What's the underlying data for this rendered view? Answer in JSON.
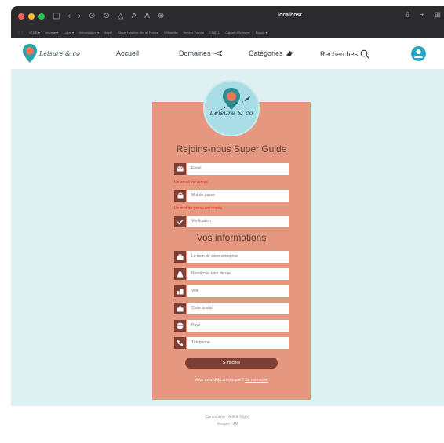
{
  "browser": {
    "url": "localhost",
    "nav_glyphs": [
      "◫",
      "‹",
      "›",
      "⊙",
      "⊙",
      "△",
      "A",
      "A",
      "⊕"
    ],
    "right_glyphs": [
      "⇧",
      "+",
      "⊞"
    ],
    "bookmarks": [
      "⋮⋮ ",
      "VTBR ▾",
      "Voyage ▾",
      "Local ▾",
      "Alimentation ▾",
      "Apple",
      "Stage Hygiène Jeu et France",
      "Wikipedia",
      "Heroes France",
      "CNRTL",
      "Caisse d'Epargne",
      "Essais ▾"
    ]
  },
  "nav": {
    "logo_text": "Leisure & co",
    "items": [
      {
        "label": "Accueil"
      },
      {
        "label": "Domaines"
      },
      {
        "label": "Catégories"
      },
      {
        "label": "Recherches"
      }
    ]
  },
  "card": {
    "logo_text": "Leisure & co",
    "title": "Rejoins-nous Super Guide",
    "fields_top": [
      {
        "placeholder": "Email",
        "icon": "envelope-icon"
      },
      {
        "placeholder": "Mot de passe",
        "icon": "lock-icon"
      },
      {
        "placeholder": "Vérification",
        "icon": "check-icon"
      }
    ],
    "errors": [
      "Un email est requis",
      "Un mot de passe est requis"
    ],
    "subtitle": "Vos informations",
    "fields_info": [
      {
        "placeholder": "Le nom de votre entreprise",
        "icon": "building-icon"
      },
      {
        "placeholder": "Numéro et nom de rue",
        "icon": "road-icon"
      },
      {
        "placeholder": "Ville",
        "icon": "city-icon"
      },
      {
        "placeholder": "Code postal",
        "icon": "mailbox-icon"
      },
      {
        "placeholder": "Pays",
        "icon": "globe-icon"
      },
      {
        "placeholder": "Téléphone",
        "icon": "phone-icon"
      }
    ],
    "submit_label": "S'inscrire",
    "login_prompt": "Vous avez déjà un compte ?",
    "login_link": "Se connecter"
  },
  "footer": {
    "line1": "Conception : Arik & Rigby",
    "line2": "Images : AB"
  },
  "colors": {
    "card": "#e59780",
    "dark_brown": "#7d3e34",
    "background": "#dff0f3",
    "error": "#d7261f",
    "avatar": "#2aa3c6"
  }
}
